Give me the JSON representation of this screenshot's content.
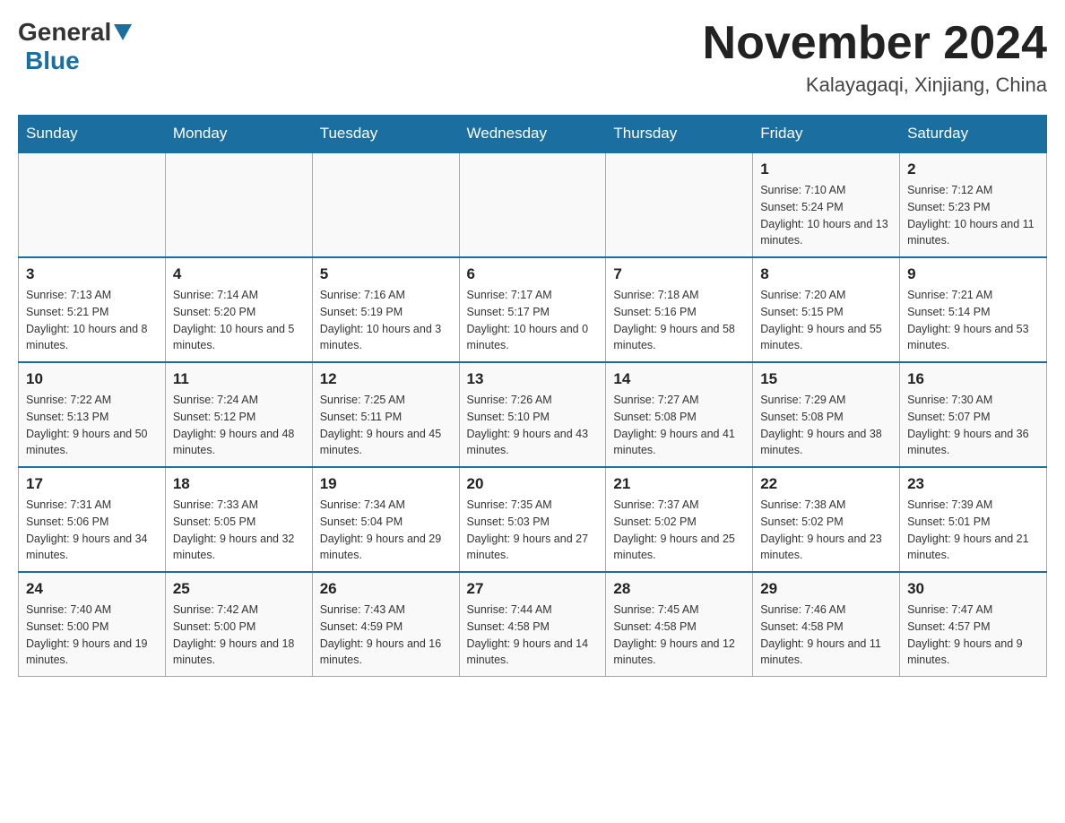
{
  "header": {
    "logo": {
      "general": "General",
      "blue": "Blue"
    },
    "title": "November 2024",
    "location": "Kalayagaqi, Xinjiang, China"
  },
  "days_of_week": [
    "Sunday",
    "Monday",
    "Tuesday",
    "Wednesday",
    "Thursday",
    "Friday",
    "Saturday"
  ],
  "weeks": [
    [
      {
        "day": "",
        "info": ""
      },
      {
        "day": "",
        "info": ""
      },
      {
        "day": "",
        "info": ""
      },
      {
        "day": "",
        "info": ""
      },
      {
        "day": "",
        "info": ""
      },
      {
        "day": "1",
        "info": "Sunrise: 7:10 AM\nSunset: 5:24 PM\nDaylight: 10 hours and 13 minutes."
      },
      {
        "day": "2",
        "info": "Sunrise: 7:12 AM\nSunset: 5:23 PM\nDaylight: 10 hours and 11 minutes."
      }
    ],
    [
      {
        "day": "3",
        "info": "Sunrise: 7:13 AM\nSunset: 5:21 PM\nDaylight: 10 hours and 8 minutes."
      },
      {
        "day": "4",
        "info": "Sunrise: 7:14 AM\nSunset: 5:20 PM\nDaylight: 10 hours and 5 minutes."
      },
      {
        "day": "5",
        "info": "Sunrise: 7:16 AM\nSunset: 5:19 PM\nDaylight: 10 hours and 3 minutes."
      },
      {
        "day": "6",
        "info": "Sunrise: 7:17 AM\nSunset: 5:17 PM\nDaylight: 10 hours and 0 minutes."
      },
      {
        "day": "7",
        "info": "Sunrise: 7:18 AM\nSunset: 5:16 PM\nDaylight: 9 hours and 58 minutes."
      },
      {
        "day": "8",
        "info": "Sunrise: 7:20 AM\nSunset: 5:15 PM\nDaylight: 9 hours and 55 minutes."
      },
      {
        "day": "9",
        "info": "Sunrise: 7:21 AM\nSunset: 5:14 PM\nDaylight: 9 hours and 53 minutes."
      }
    ],
    [
      {
        "day": "10",
        "info": "Sunrise: 7:22 AM\nSunset: 5:13 PM\nDaylight: 9 hours and 50 minutes."
      },
      {
        "day": "11",
        "info": "Sunrise: 7:24 AM\nSunset: 5:12 PM\nDaylight: 9 hours and 48 minutes."
      },
      {
        "day": "12",
        "info": "Sunrise: 7:25 AM\nSunset: 5:11 PM\nDaylight: 9 hours and 45 minutes."
      },
      {
        "day": "13",
        "info": "Sunrise: 7:26 AM\nSunset: 5:10 PM\nDaylight: 9 hours and 43 minutes."
      },
      {
        "day": "14",
        "info": "Sunrise: 7:27 AM\nSunset: 5:08 PM\nDaylight: 9 hours and 41 minutes."
      },
      {
        "day": "15",
        "info": "Sunrise: 7:29 AM\nSunset: 5:08 PM\nDaylight: 9 hours and 38 minutes."
      },
      {
        "day": "16",
        "info": "Sunrise: 7:30 AM\nSunset: 5:07 PM\nDaylight: 9 hours and 36 minutes."
      }
    ],
    [
      {
        "day": "17",
        "info": "Sunrise: 7:31 AM\nSunset: 5:06 PM\nDaylight: 9 hours and 34 minutes."
      },
      {
        "day": "18",
        "info": "Sunrise: 7:33 AM\nSunset: 5:05 PM\nDaylight: 9 hours and 32 minutes."
      },
      {
        "day": "19",
        "info": "Sunrise: 7:34 AM\nSunset: 5:04 PM\nDaylight: 9 hours and 29 minutes."
      },
      {
        "day": "20",
        "info": "Sunrise: 7:35 AM\nSunset: 5:03 PM\nDaylight: 9 hours and 27 minutes."
      },
      {
        "day": "21",
        "info": "Sunrise: 7:37 AM\nSunset: 5:02 PM\nDaylight: 9 hours and 25 minutes."
      },
      {
        "day": "22",
        "info": "Sunrise: 7:38 AM\nSunset: 5:02 PM\nDaylight: 9 hours and 23 minutes."
      },
      {
        "day": "23",
        "info": "Sunrise: 7:39 AM\nSunset: 5:01 PM\nDaylight: 9 hours and 21 minutes."
      }
    ],
    [
      {
        "day": "24",
        "info": "Sunrise: 7:40 AM\nSunset: 5:00 PM\nDaylight: 9 hours and 19 minutes."
      },
      {
        "day": "25",
        "info": "Sunrise: 7:42 AM\nSunset: 5:00 PM\nDaylight: 9 hours and 18 minutes."
      },
      {
        "day": "26",
        "info": "Sunrise: 7:43 AM\nSunset: 4:59 PM\nDaylight: 9 hours and 16 minutes."
      },
      {
        "day": "27",
        "info": "Sunrise: 7:44 AM\nSunset: 4:58 PM\nDaylight: 9 hours and 14 minutes."
      },
      {
        "day": "28",
        "info": "Sunrise: 7:45 AM\nSunset: 4:58 PM\nDaylight: 9 hours and 12 minutes."
      },
      {
        "day": "29",
        "info": "Sunrise: 7:46 AM\nSunset: 4:58 PM\nDaylight: 9 hours and 11 minutes."
      },
      {
        "day": "30",
        "info": "Sunrise: 7:47 AM\nSunset: 4:57 PM\nDaylight: 9 hours and 9 minutes."
      }
    ]
  ]
}
